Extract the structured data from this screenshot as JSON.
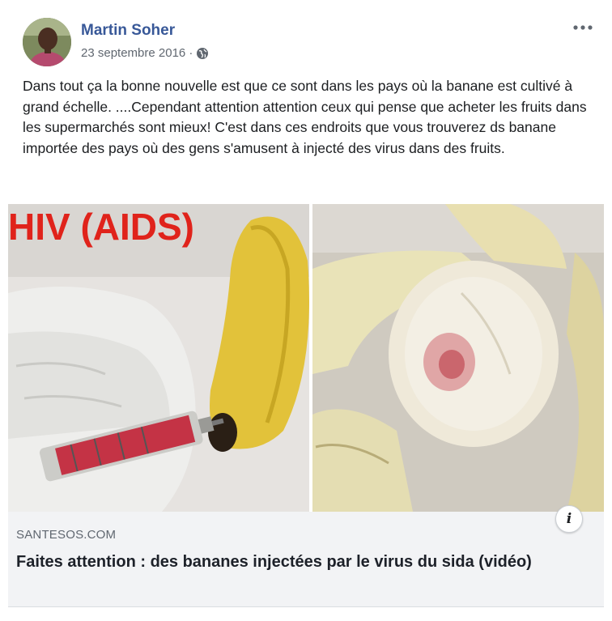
{
  "post": {
    "author": "Martin Soher",
    "date": "23 septembre 2016 · ",
    "privacy_icon": "globe-icon",
    "more_icon": "ellipsis-icon",
    "text": "Dans tout ça la bonne nouvelle est que ce sont dans les pays où la banane est cultivé à grand échelle. ....Cependant attention attention ceux qui pense que acheter les fruits dans les supermarchés sont mieux! C'est dans ces endroits que vous trouverez ds banane importée des pays où des gens s'amusent à injecté des virus dans des fruits."
  },
  "link": {
    "image_overlay_text": "HIV (AIDS)",
    "domain": "SANTESOS.COM",
    "headline": "Faites attention : des bananes injectées par le virus du sida (vidéo)",
    "info_label": "i"
  },
  "colors": {
    "author_link": "#385898",
    "overlay_text": "#e0231b",
    "card_footer": "#f2f3f5"
  }
}
